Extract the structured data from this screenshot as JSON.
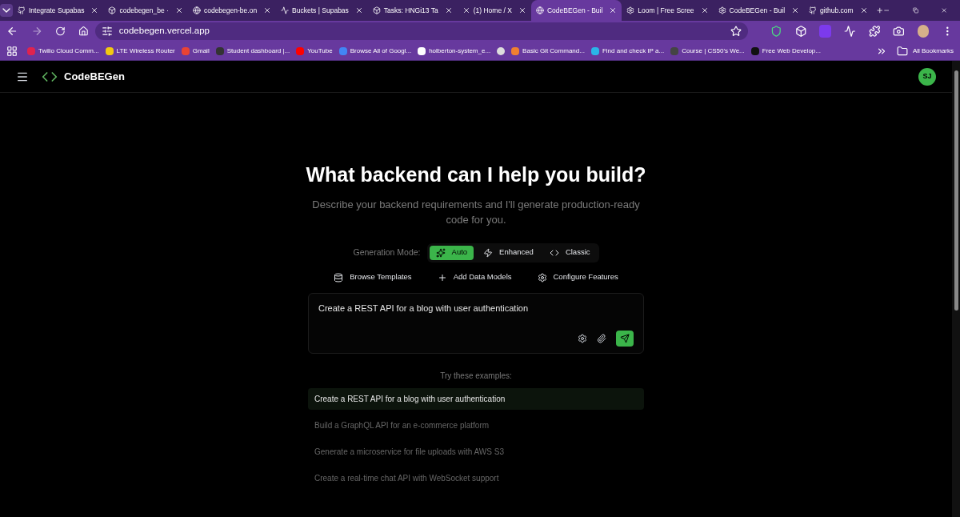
{
  "browser": {
    "tabs": [
      {
        "title": "Integrate Supabas",
        "selected": false
      },
      {
        "title": "codebegen_be ·",
        "selected": false
      },
      {
        "title": "codebegen-be.on",
        "selected": false
      },
      {
        "title": "Buckets | Supabas",
        "selected": false
      },
      {
        "title": "Tasks: HNGi13 Ta",
        "selected": false
      },
      {
        "title": "(1) Home / X",
        "selected": false
      },
      {
        "title": "CodeBEGen - Buil",
        "selected": true
      },
      {
        "title": "Loom | Free Scree",
        "selected": false
      },
      {
        "title": "CodeBEGen - Buil",
        "selected": false
      },
      {
        "title": "github.com",
        "selected": false
      }
    ],
    "url": "codebegen.vercel.app",
    "bookmarks": [
      {
        "title": "Twilio Cloud Comm...",
        "color": "#e0234e"
      },
      {
        "title": "LTE Wireless Router",
        "color": "#f2c811"
      },
      {
        "title": "Gmail",
        "color": "#ea4335"
      },
      {
        "title": "Student dashboard |...",
        "color": "#333333"
      },
      {
        "title": "YouTube",
        "color": "#ff0000"
      },
      {
        "title": "Browse All of Googl...",
        "color": "#4285f4"
      },
      {
        "title": "holberton-system_e...",
        "color": "#ffffff"
      },
      {
        "color": "#dddddd"
      },
      {
        "title": "Basic Git Command...",
        "color": "#f08030"
      },
      {
        "title": "Find and check IP a...",
        "color": "#2bb5e8"
      },
      {
        "title": "Course | CS50's We...",
        "color": "#444444"
      },
      {
        "title": "Free Web Develop...",
        "color": "#111111"
      }
    ],
    "all_bookmarks": "All Bookmarks"
  },
  "app": {
    "brand": "CodeBEGen",
    "avatar": "SJ",
    "heading": "What backend can I help you build?",
    "subtitle": "Describe your backend requirements and I'll generate production-ready code for you.",
    "mode_label": "Generation Mode:",
    "modes": [
      {
        "label": "Auto",
        "selected": true
      },
      {
        "label": "Enhanced",
        "selected": false
      },
      {
        "label": "Classic",
        "selected": false
      }
    ],
    "actions": [
      {
        "label": "Browse Templates"
      },
      {
        "label": "Add Data Models"
      },
      {
        "label": "Configure Features"
      }
    ],
    "prompt": "Create a REST API for a blog with user authentication",
    "examples_title": "Try these examples:",
    "examples": [
      {
        "text": "Create a REST API for a blog with user authentication",
        "selected": true
      },
      {
        "text": "Build a GraphQL API for an e-commerce platform",
        "selected": false
      },
      {
        "text": "Generate a microservice for file uploads with AWS S3",
        "selected": false
      },
      {
        "text": "Create a real-time chat API with WebSocket support",
        "selected": false
      }
    ]
  }
}
